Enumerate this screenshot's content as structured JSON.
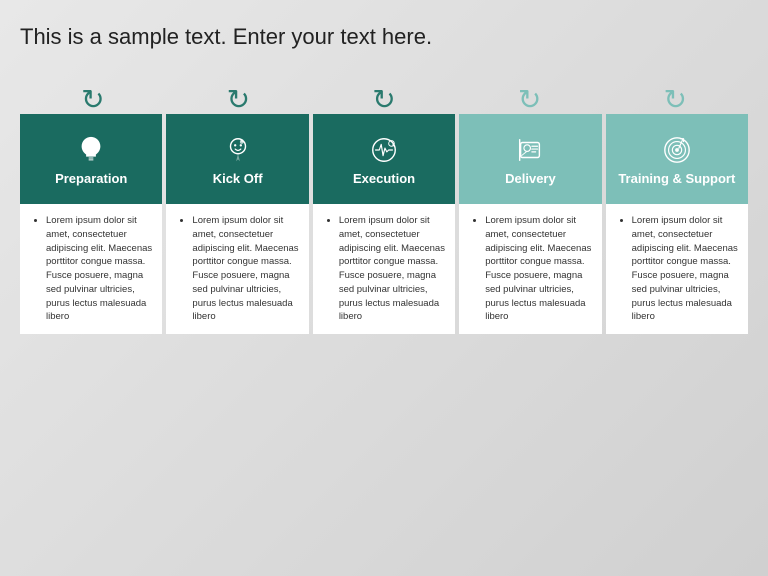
{
  "title": "This is a sample text. Enter your text here.",
  "columns": [
    {
      "id": "preparation",
      "label": "Preparation",
      "icon": "bulb",
      "dark": true,
      "body_text": "Lorem ipsum dolor sit amet, consectetuer adipiscing elit. Maecenas porttitor congue massa. Fusce posuere, magna sed pulvinar ultricies, purus lectus malesuada libero"
    },
    {
      "id": "kickoff",
      "label": "Kick Off",
      "icon": "head",
      "dark": true,
      "body_text": "Lorem ipsum dolor sit amet, consectetuer adipiscing elit. Maecenas porttitor congue massa. Fusce posuere, magna sed pulvinar ultricies, purus lectus malesuada libero"
    },
    {
      "id": "execution",
      "label": "Execution",
      "icon": "pulse",
      "dark": true,
      "body_text": "Lorem ipsum dolor sit amet, consectetuer adipiscing elit. Maecenas porttitor congue massa. Fusce posuere, magna sed pulvinar ultricies, purus lectus malesuada libero"
    },
    {
      "id": "delivery",
      "label": "Delivery",
      "icon": "badge",
      "dark": false,
      "body_text": "Lorem ipsum dolor sit amet, consectetuer adipiscing elit. Maecenas porttitor congue massa. Fusce posuere, magna sed pulvinar ultricies, purus lectus malesuada libero"
    },
    {
      "id": "training",
      "label": "Training & Support",
      "icon": "target",
      "dark": false,
      "body_text": "Lorem ipsum dolor sit amet, consectetuer adipiscing elit. Maecenas porttitor congue massa. Fusce posuere, magna sed pulvinar ultricies, purus lectus malesuada libero"
    }
  ],
  "colors": {
    "dark": "#1a6b60",
    "light": "#7dbfb8",
    "arrow_dark": "#1a6b60",
    "arrow_light": "#7dbfb8"
  }
}
